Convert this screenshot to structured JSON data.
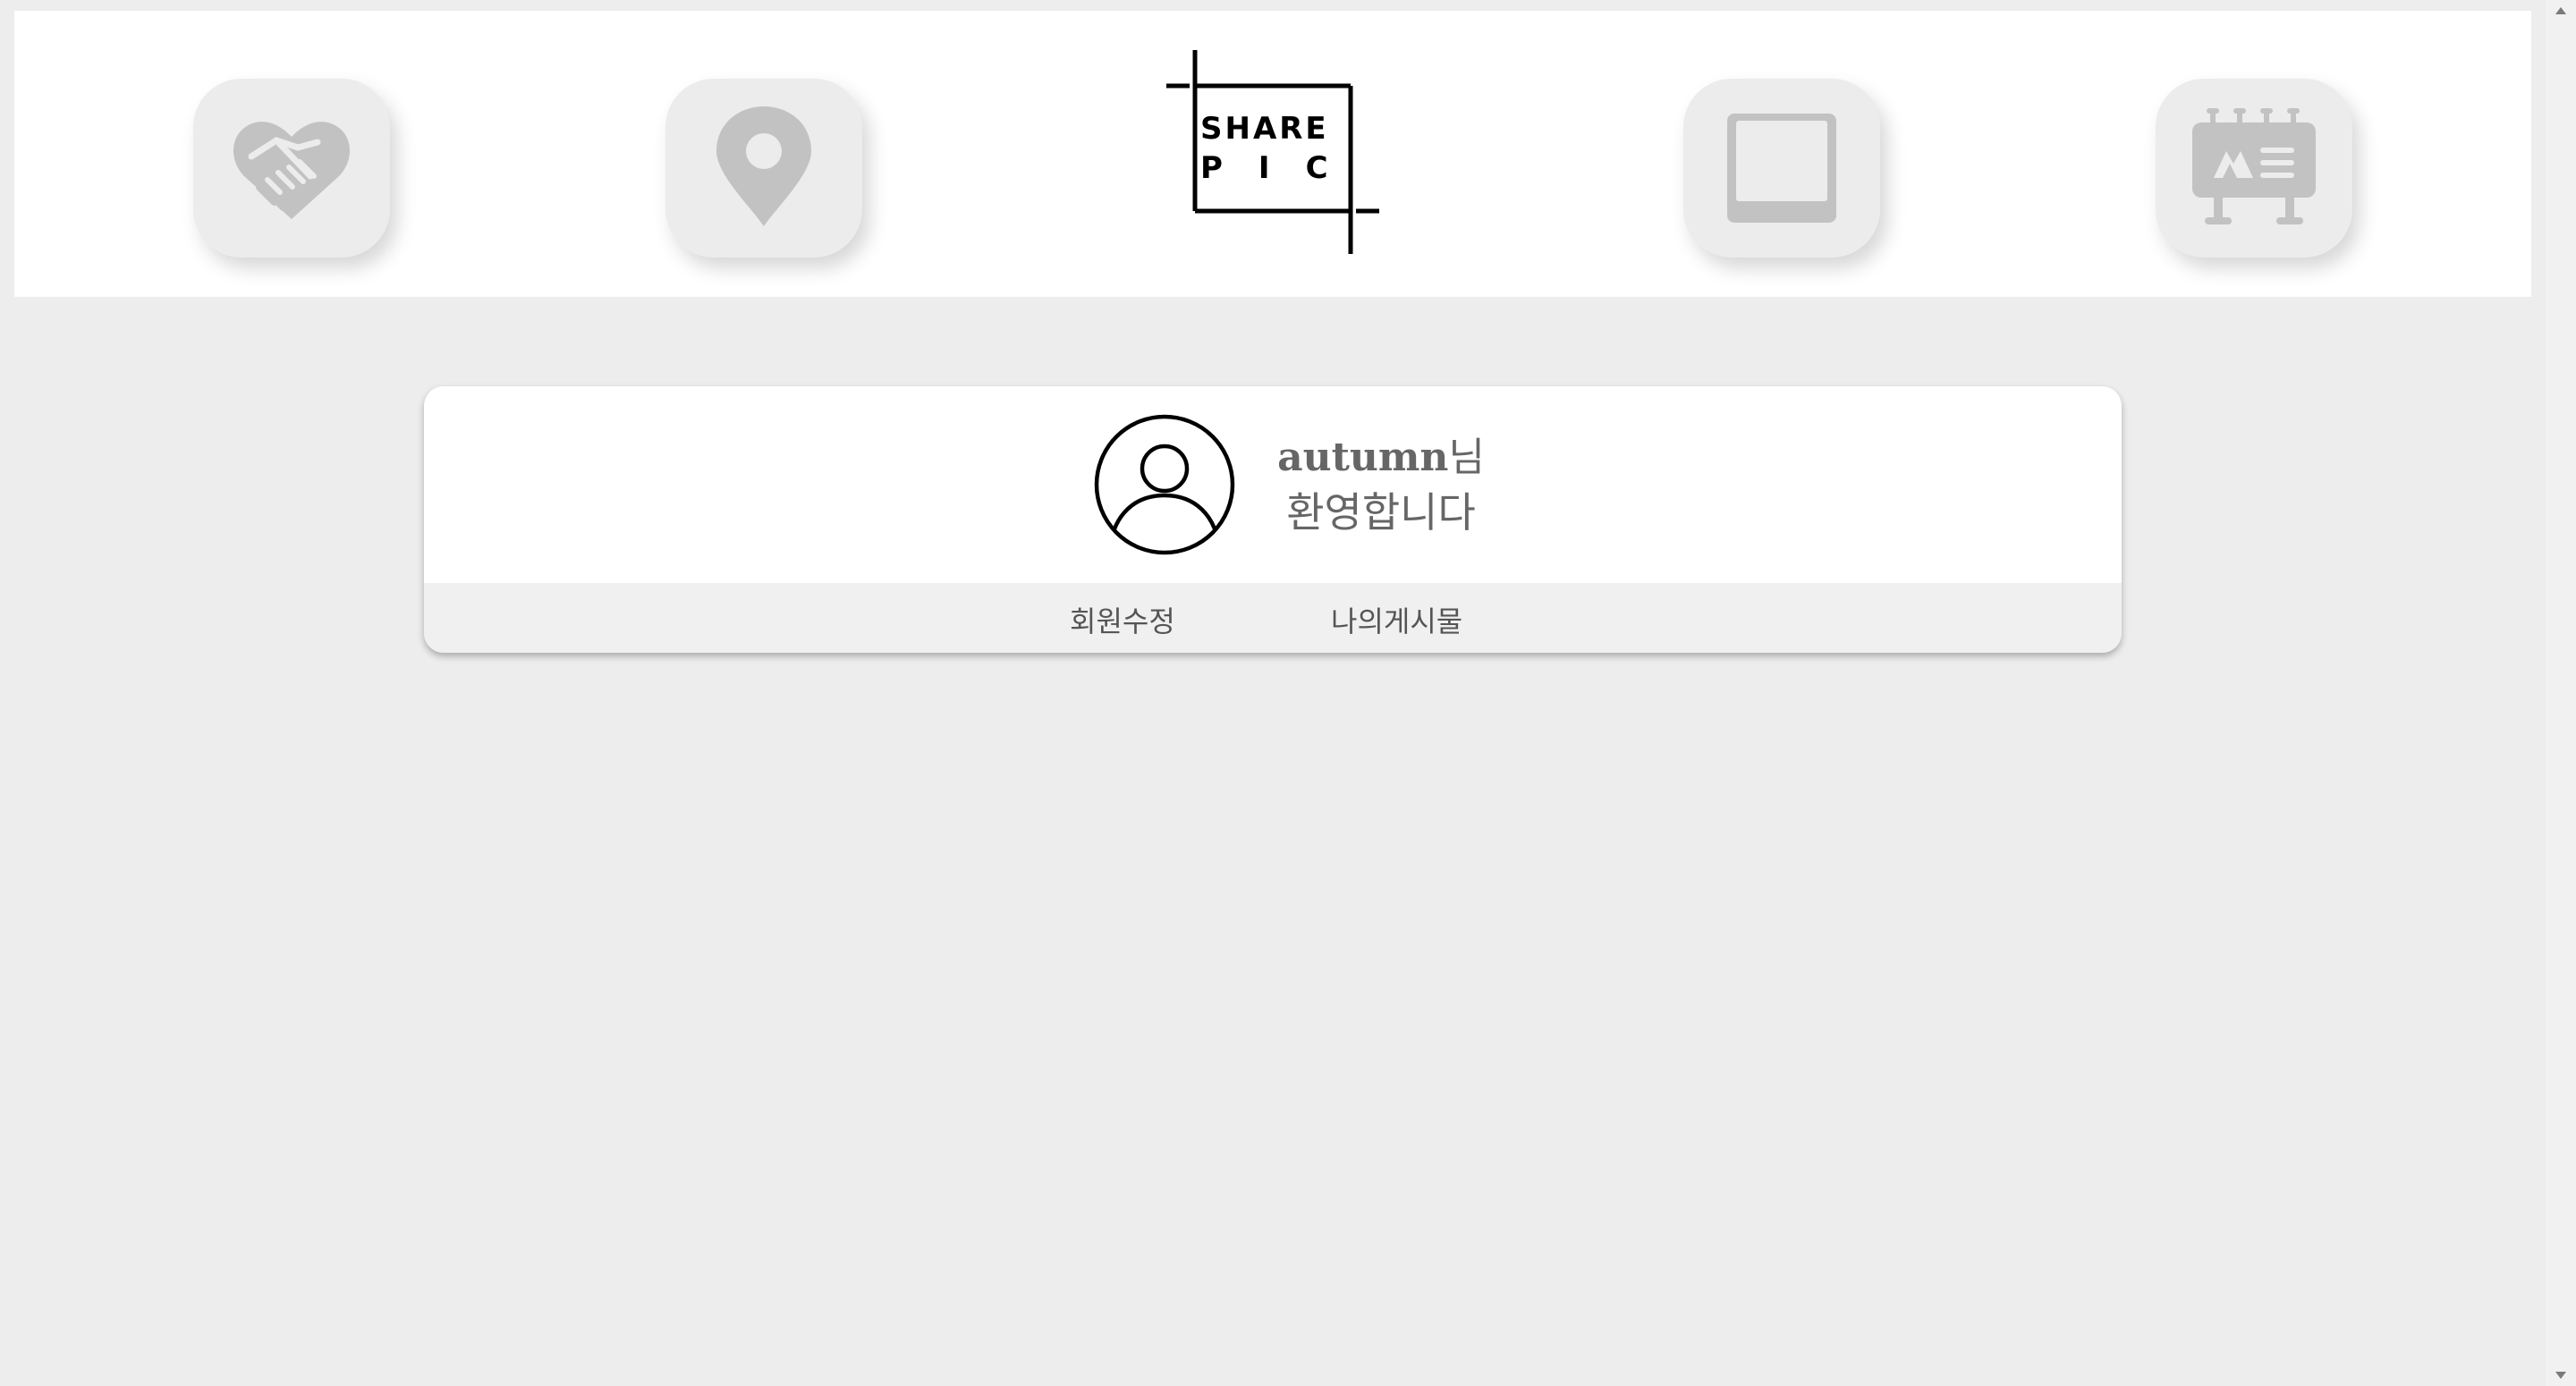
{
  "header": {
    "logo": {
      "line1": "SHARE",
      "line2": "PIC"
    },
    "nav_icons": [
      "handshake-heart-icon",
      "map-pin-icon",
      "picture-frame-icon",
      "billboard-icon"
    ],
    "icon_color": "#c2c2c2"
  },
  "profile": {
    "username": "autumn",
    "honorific": "님",
    "welcome": "환영합니다"
  },
  "tabs": {
    "edit_member": "회원수정",
    "my_posts": "나의게시물"
  },
  "colors": {
    "background": "#ededed",
    "card": "#ffffff",
    "tab_bar": "#f0f0f0",
    "text_gray": "#666666"
  }
}
